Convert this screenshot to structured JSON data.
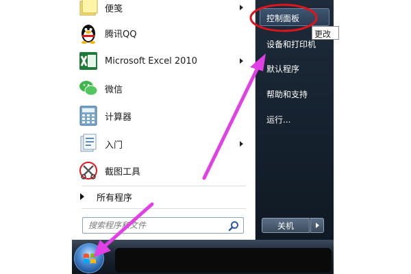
{
  "programs": [
    {
      "label": "便笺",
      "icon": "sticky-notes-icon",
      "has_submenu": true
    },
    {
      "label": "腾讯QQ",
      "icon": "qq-penguin-icon",
      "has_submenu": false
    },
    {
      "label": "Microsoft Excel 2010",
      "icon": "excel-icon",
      "has_submenu": true
    },
    {
      "label": "微信",
      "icon": "wechat-icon",
      "has_submenu": false
    },
    {
      "label": "计算器",
      "icon": "calculator-icon",
      "has_submenu": false
    },
    {
      "label": "入门",
      "icon": "getting-started-icon",
      "has_submenu": true
    },
    {
      "label": "截图工具",
      "icon": "snipping-tool-icon",
      "has_submenu": false
    }
  ],
  "all_programs_label": "所有程序",
  "search": {
    "placeholder": "搜索程序和文件"
  },
  "right_items": [
    {
      "label": "控制面板"
    },
    {
      "label": "设备和打印机"
    },
    {
      "label": "默认程序"
    },
    {
      "label": "帮助和支持"
    },
    {
      "label": "运行..."
    }
  ],
  "tooltip": "更改",
  "shutdown_label": "关机",
  "colors": {
    "annotation_red": "#e0141b",
    "annotation_arrow": "#e040e6",
    "right_pane": "#1a2633"
  }
}
